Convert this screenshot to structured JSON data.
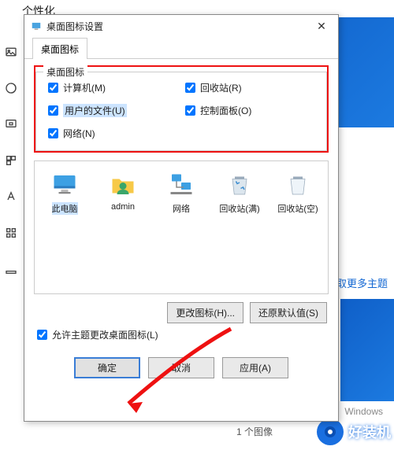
{
  "settings": {
    "title": "个性化"
  },
  "dialog": {
    "title": "桌面图标设置",
    "tab": "桌面图标",
    "group_title": "桌面图标",
    "checks": {
      "computer": "计算机(M)",
      "recycle": "回收站(R)",
      "userfiles": "用户的文件(U)",
      "control": "控制面板(O)",
      "network": "网络(N)"
    },
    "icons": {
      "thispc": "此电脑",
      "admin": "admin",
      "network": "网络",
      "recycle_full": "回收站(满)",
      "recycle_empty": "回收站(空)"
    },
    "change_icon": "更改图标(H)...",
    "restore_default": "还原默认值(S)",
    "allow_theme": "允许主题更改桌面图标(L)",
    "ok": "确定",
    "cancel": "取消",
    "apply": "应用(A)"
  },
  "right": {
    "theme_link": "获取更多主题",
    "below": "1 个图像",
    "windows": "Windows",
    "brand": "好装机"
  }
}
